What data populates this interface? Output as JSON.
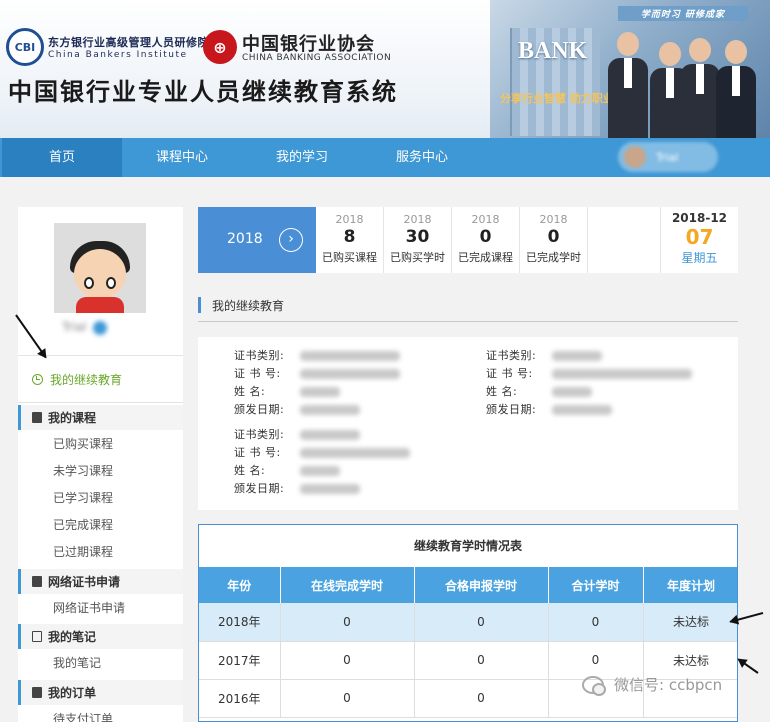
{
  "header": {
    "institute_cn": "东方银行业高级管理人员研修院",
    "institute_en": "China Bankers Institute",
    "association_cn": "中国银行业协会",
    "association_en": "CHINA BANKING ASSOCIATION",
    "system_title": "中国银行业专业人员继续教育系统",
    "banner_tag": "学而时习 研修成家",
    "banner_word": "BANK",
    "banner_slogan": "分享行业智慧 助力职业生涯"
  },
  "nav": {
    "items": [
      "首页",
      "课程中心",
      "我的学习",
      "服务中心"
    ],
    "active_index": 0,
    "user_name": "Trial"
  },
  "sidebar": {
    "user_name": "Trial",
    "active_item": "我的继续教育",
    "groups": [
      {
        "title": "我的课程",
        "items": [
          "已购买课程",
          "未学习课程",
          "已学习课程",
          "已完成课程",
          "已过期课程"
        ]
      },
      {
        "title": "网络证书申请",
        "items": [
          "网络证书申请"
        ]
      },
      {
        "title": "我的笔记",
        "items": [
          "我的笔记"
        ]
      },
      {
        "title": "我的订单",
        "items": [
          "待支付订单"
        ]
      }
    ]
  },
  "stats": {
    "year": "2018",
    "next_icon": "chevron-right-icon",
    "items": [
      {
        "year": "2018",
        "value": "8",
        "label": "已购买课程"
      },
      {
        "year": "2018",
        "value": "30",
        "label": "已购买学时"
      },
      {
        "year": "2018",
        "value": "0",
        "label": "已完成课程"
      },
      {
        "year": "2018",
        "value": "0",
        "label": "已完成学时"
      }
    ],
    "date": {
      "year_month": "2018-12",
      "day": "07",
      "weekday": "星期五"
    }
  },
  "section_title": "我的继续教育",
  "certificates": {
    "labels": [
      "证书类别:",
      "证 书 号:",
      "姓     名:",
      "颁发日期:"
    ]
  },
  "study_table": {
    "title": "继续教育学时情况表",
    "headers": [
      "年份",
      "在线完成学时",
      "合格申报学时",
      "合计学时",
      "年度计划"
    ],
    "rows": [
      [
        "2018年",
        "0",
        "0",
        "0",
        "未达标"
      ],
      [
        "2017年",
        "0",
        "0",
        "0",
        "未达标"
      ],
      [
        "2016年",
        "0",
        "0",
        "",
        ""
      ]
    ]
  },
  "watermark": "微信号: ccbpcn",
  "colors": {
    "nav": "#3f98d6",
    "accent": "#4a8fd5",
    "active_green": "#6aa82a",
    "date_orange": "#f5a623"
  }
}
